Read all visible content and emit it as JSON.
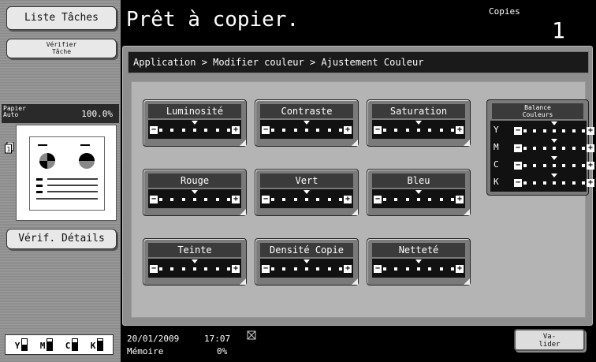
{
  "left": {
    "liste_taches": "Liste Tâches",
    "verifier_tache_line1": "Vérifier",
    "verifier_tache_line2": "Tâche",
    "papier_line1": "Papier",
    "papier_line2": "Auto",
    "zoom": "100.0%",
    "verif_details": "Vérif. Détails",
    "toner": [
      {
        "letter": "Y",
        "level": 0.5
      },
      {
        "letter": "M",
        "level": 0.8
      },
      {
        "letter": "C",
        "level": 0.7
      },
      {
        "letter": "K",
        "level": 0.85
      }
    ]
  },
  "header": {
    "title": "Prêt à copier.",
    "copies_label": "Copies",
    "copies_value": "1"
  },
  "main": {
    "breadcrumb": "Application > Modifier couleur > Ajustement Couleur",
    "tiles": [
      {
        "label": "Luminosité",
        "level": 0
      },
      {
        "label": "Contraste",
        "level": 0
      },
      {
        "label": "Saturation",
        "level": 0
      },
      {
        "label": "Rouge",
        "level": 0
      },
      {
        "label": "Vert",
        "level": 0
      },
      {
        "label": "Bleu",
        "level": 0
      },
      {
        "label": "Teinte",
        "level": 0
      },
      {
        "label": "Densité Copie",
        "level": 0
      },
      {
        "label": "Netteté",
        "level": 0
      }
    ],
    "balance": {
      "title_line1": "Balance",
      "title_line2": "Couleurs",
      "rows": [
        "Y",
        "M",
        "C",
        "K"
      ]
    }
  },
  "footer": {
    "date": "20/01/2009",
    "time": "17:07",
    "memory_label": "Mémoire",
    "memory_value": "0%",
    "valider_line1": "Va-",
    "valider_line2": "lider"
  },
  "icons": {
    "network": "network-icon",
    "copies_stack": "document-stack-icon"
  }
}
